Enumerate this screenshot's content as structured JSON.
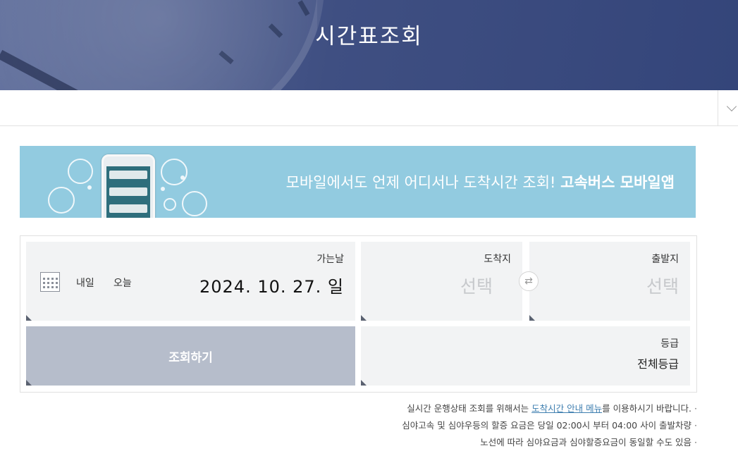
{
  "header": {
    "title": "시간표조회"
  },
  "promo": {
    "text": "모바일에서도 언제 어디서나 도착시간 조회! ",
    "bold": "고속버스 모바일앱"
  },
  "form": {
    "departure": {
      "label": "출발지",
      "placeholder": "선택"
    },
    "arrival": {
      "label": "도착지",
      "placeholder": "선택"
    },
    "date": {
      "label": "가는날",
      "value": "2024. 10. 27. 일",
      "today": "오늘",
      "tomorrow": "내일"
    },
    "grade": {
      "label": "등급",
      "value": "전체등급"
    },
    "search_label": "조회하기"
  },
  "notes": {
    "line1_pre": "실시간 운행상태 조회를 위해서는 ",
    "line1_link": "도착시간 안내 메뉴",
    "line1_post": "를 이용하시기 바랍니다.",
    "line2": "심야고속 및 심야우등의 할증 요금은 당일 02:00시 부터 04:00 사이 출발차량",
    "line3": "노선에 따라 심야요금과 심야할증요금이 동일할 수도 있음"
  },
  "colors": {
    "hero": "#3f4f82",
    "promo": "#92cbe0",
    "search_button": "#b6bdcb"
  }
}
